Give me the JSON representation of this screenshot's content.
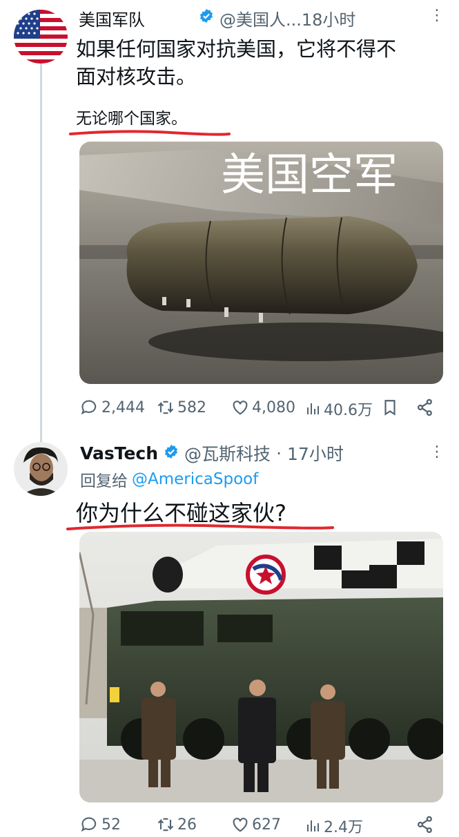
{
  "tweet1": {
    "name": "美国军队",
    "handle_time": "@美国人...18小时",
    "line1": "如果任何国家对抗美国，它将不得不",
    "line2": "面对核攻击。",
    "line3": "无论哪个国家。",
    "media_caption": "美国空军",
    "stats": {
      "replies": "2,444",
      "retweets": "582",
      "likes": "4,080",
      "views": "40.6万"
    }
  },
  "tweet2": {
    "name": "VasTech",
    "handle": "@瓦斯科技",
    "separator": "·",
    "time": "17小时",
    "reply_prefix": "回复给",
    "reply_to": "@AmericaSpoof",
    "line1": "你为什么不碰这家伙?",
    "stats": {
      "replies": "52",
      "retweets": "26",
      "likes": "627",
      "views": "2.4万"
    }
  },
  "colors": {
    "verified": "#1d9bf0",
    "underline": "#e0282e",
    "muted": "#536471"
  },
  "icons": [
    "reply-icon",
    "retweet-icon",
    "like-icon",
    "views-icon",
    "bookmark-icon",
    "share-icon",
    "verified-badge-icon",
    "more-icon"
  ]
}
